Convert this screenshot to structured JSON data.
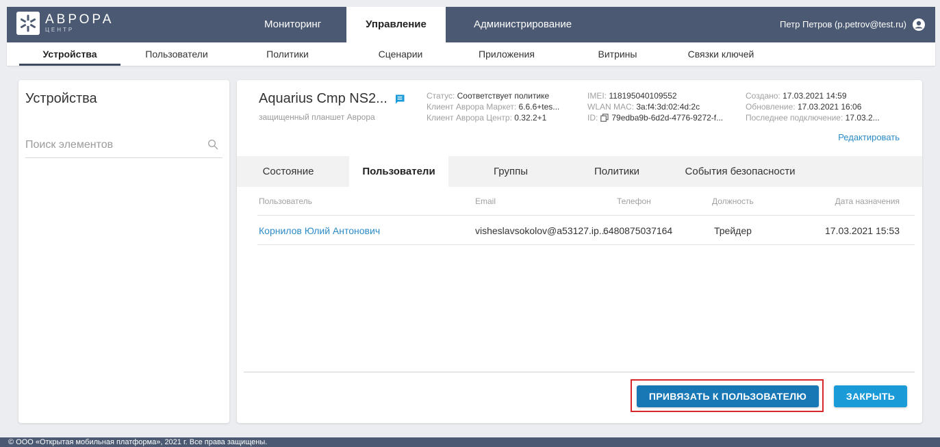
{
  "brand": {
    "title": "АВРОРА",
    "subtitle": "ЦЕНТР"
  },
  "top_nav": [
    {
      "label": "Мониторинг"
    },
    {
      "label": "Управление",
      "active": true
    },
    {
      "label": "Администрирование"
    }
  ],
  "user": {
    "name": "Петр Петров (p.petrov@test.ru)"
  },
  "sub_nav": [
    {
      "label": "Устройства",
      "active": true
    },
    {
      "label": "Пользователи"
    },
    {
      "label": "Политики"
    },
    {
      "label": "Сценарии"
    },
    {
      "label": "Приложения"
    },
    {
      "label": "Витрины"
    },
    {
      "label": "Связки ключей"
    }
  ],
  "left_panel": {
    "title": "Устройства",
    "search_placeholder": "Поиск элементов"
  },
  "device": {
    "name": "Aquarius Cmp NS2...",
    "subtitle": "защищенный планшет Аврора",
    "status_label": "Статус:",
    "status_value": "Соответствует политике",
    "market_label": "Клиент Аврора Маркет:",
    "market_value": "6.6.6+tes...",
    "center_label": "Клиент Аврора Центр:",
    "center_value": "0.32.2+1",
    "imei_label": "IMEI:",
    "imei_value": "118195040109552",
    "wlan_label": "WLAN MAC:",
    "wlan_value": "3a:f4:3d:02:4d:2c",
    "id_label": "ID:",
    "id_value": "79edba9b-6d2d-4776-9272-f...",
    "created_label": "Создано:",
    "created_value": "17.03.2021 14:59",
    "updated_label": "Обновление:",
    "updated_value": "17.03.2021 16:06",
    "last_conn_label": "Последнее подключение:",
    "last_conn_value": "17.03.2...",
    "edit_label": "Редактировать"
  },
  "tabs": [
    {
      "label": "Состояние"
    },
    {
      "label": "Пользователи",
      "active": true
    },
    {
      "label": "Группы"
    },
    {
      "label": "Политики"
    },
    {
      "label": "События безопасности"
    }
  ],
  "table": {
    "columns": [
      "Пользователь",
      "Email",
      "Телефон",
      "Должность",
      "Дата назначения"
    ],
    "rows": [
      {
        "user": "Корнилов Юлий Антонович",
        "email": "visheslavsokolov@a53127.ip...",
        "phone": "6480875037164",
        "position": "Трейдер",
        "date": "17.03.2021 15:53"
      }
    ]
  },
  "buttons": {
    "bind": "ПРИВЯЗАТЬ К ПОЛЬЗОВАТЕЛЮ",
    "close": "ЗАКРЫТЬ"
  },
  "footer": {
    "text": "© ООО «Открытая мобильная платформа», 2021 г. Все права защищены."
  },
  "colors": {
    "header": "#4b5a72",
    "accent": "#1a9bd7",
    "link": "#2b8bc7",
    "highlight": "#d9262a"
  }
}
